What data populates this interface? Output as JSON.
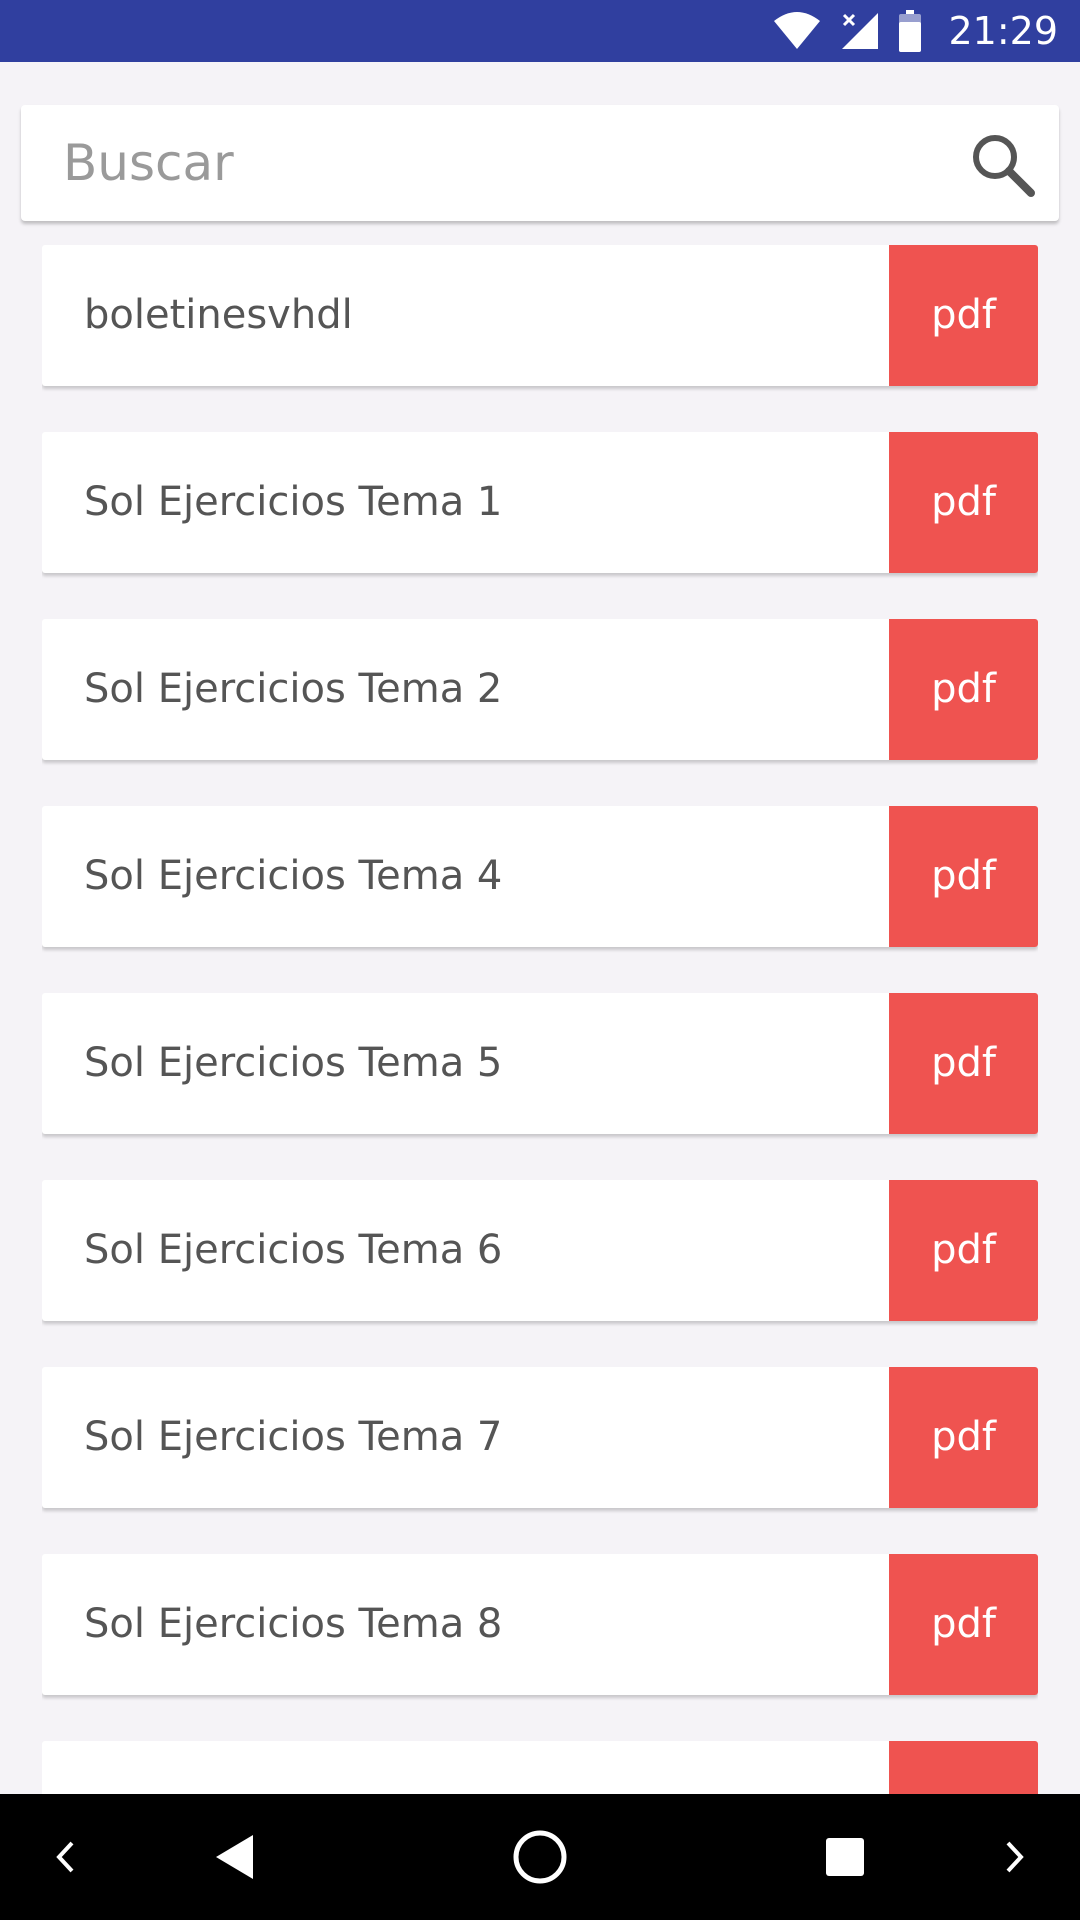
{
  "status_bar": {
    "time": "21:29",
    "icons": [
      "wifi-icon",
      "signal-icon",
      "battery-icon"
    ]
  },
  "search": {
    "placeholder": "Buscar",
    "value": "",
    "icon": "search-icon"
  },
  "files": [
    {
      "name": "boletinesvhdl",
      "action": "pdf"
    },
    {
      "name": "Sol Ejercicios Tema 1",
      "action": "pdf"
    },
    {
      "name": "Sol Ejercicios Tema 2",
      "action": "pdf"
    },
    {
      "name": "Sol Ejercicios Tema 4",
      "action": "pdf"
    },
    {
      "name": "Sol Ejercicios Tema 5",
      "action": "pdf"
    },
    {
      "name": "Sol Ejercicios Tema 6",
      "action": "pdf"
    },
    {
      "name": "Sol Ejercicios Tema 7",
      "action": "pdf"
    },
    {
      "name": "Sol Ejercicios Tema 8",
      "action": "pdf"
    },
    {
      "name": "",
      "action": ""
    }
  ],
  "nav_bar": {
    "icons": [
      "chevron-left-icon",
      "back-icon",
      "home-icon",
      "recents-icon",
      "chevron-right-icon"
    ]
  },
  "colors": {
    "status_bar": "#303f9f",
    "pdf_button": "#ef5350",
    "background": "#f5f3f7",
    "text": "#555555"
  }
}
